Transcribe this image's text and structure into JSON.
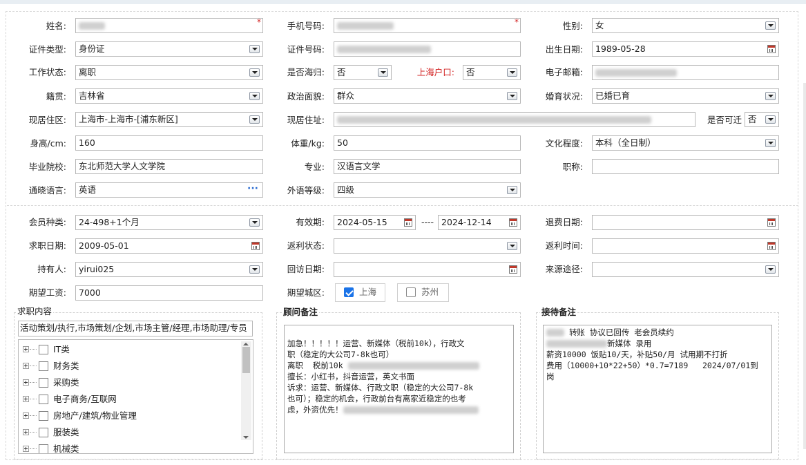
{
  "form": {
    "name": {
      "label": "姓名:",
      "value": ""
    },
    "phone": {
      "label": "手机号码:",
      "value": ""
    },
    "gender": {
      "label": "性别:",
      "value": "女"
    },
    "id_type": {
      "label": "证件类型:",
      "value": "身份证"
    },
    "id_number": {
      "label": "证件号码:",
      "value": ""
    },
    "birth_date": {
      "label": "出生日期:",
      "value": "1989-05-28"
    },
    "work_status": {
      "label": "工作状态:",
      "value": "离职"
    },
    "returnee": {
      "label": "是否海归:",
      "value": "否"
    },
    "sh_hukou": {
      "label": "上海户口:",
      "value": "否"
    },
    "email": {
      "label": "电子邮箱:",
      "value": ""
    },
    "native_place": {
      "label": "籍贯:",
      "value": "吉林省"
    },
    "political": {
      "label": "政治面貌:",
      "value": "群众"
    },
    "marital": {
      "label": "婚育状况:",
      "value": "已婚已育"
    },
    "residence_area": {
      "label": "现居住区:",
      "value": "上海市-上海市-[浦东新区]"
    },
    "residence_addr": {
      "label": "现居住址:",
      "value": ""
    },
    "relocatable": {
      "label": "是否可迁",
      "value": "否"
    },
    "height": {
      "label": "身高/cm:",
      "value": "160"
    },
    "weight": {
      "label": "体重/kg:",
      "value": "50"
    },
    "education": {
      "label": "文化程度:",
      "value": "本科（全日制）"
    },
    "school": {
      "label": "毕业院校:",
      "value": "东北师范大学人文学院"
    },
    "major": {
      "label": "专业:",
      "value": "汉语言文学"
    },
    "title": {
      "label": "职称:",
      "value": ""
    },
    "languages": {
      "label": "通晓语言:",
      "value": "英语"
    },
    "foreign_level": {
      "label": "外语等级:",
      "value": "四级"
    }
  },
  "member": {
    "type": {
      "label": "会员种类:",
      "value": "24-498+1个月"
    },
    "validity": {
      "label": "有效期:",
      "from": "2024-05-15",
      "sep": "----",
      "to": "2024-12-14"
    },
    "refund_date": {
      "label": "退费日期:",
      "value": ""
    },
    "job_date": {
      "label": "求职日期:",
      "value": "2009-05-01"
    },
    "rebate_status": {
      "label": "返利状态:",
      "value": ""
    },
    "rebate_time": {
      "label": "返利时间:",
      "value": ""
    },
    "holder": {
      "label": "持有人:",
      "value": "yirui025"
    },
    "visit_date": {
      "label": "回访日期:",
      "value": ""
    },
    "source": {
      "label": "来源途径:",
      "value": ""
    },
    "salary": {
      "label": "期望工资:",
      "value": "7000"
    },
    "city": {
      "label": "期望城区:",
      "options": [
        {
          "label": "上海",
          "checked": true
        },
        {
          "label": "苏州",
          "checked": false
        }
      ]
    }
  },
  "job_content": {
    "title": "求职内容",
    "summary": "活动策划/执行,市场策划/企划,市场主管/经理,市场助理/专员",
    "tree": [
      "IT类",
      "财务类",
      "采购类",
      "电子商务/互联网",
      "房地产/建筑/物业管理",
      "服装类",
      "机械类"
    ]
  },
  "advisor_notes": {
    "title": "顾问备注",
    "lines": [
      "加急！！！！！运营、新媒体（税前10k），行政文",
      "职（稳定的大公司7-8k也可）",
      "",
      "离职  税前10k",
      "擅长：小红书，抖音运营，英文书面",
      "诉求：运营、新媒体、行政文职（稳定的大公司7-8k",
      "也可）；稳定的机会，行政前台有离家近稳定的也考",
      "虑，外资优先！"
    ]
  },
  "reception_notes": {
    "title": "接待备注",
    "lines": [
      "转账 协议已回传 老会员续约",
      "",
      "新媒体 录用",
      "薪资10000 饭贴10/天，补贴50/月 试用期不打折",
      "费用（10000+10*22+50）*0.7=7189   2024/07/01到",
      "岗"
    ]
  }
}
